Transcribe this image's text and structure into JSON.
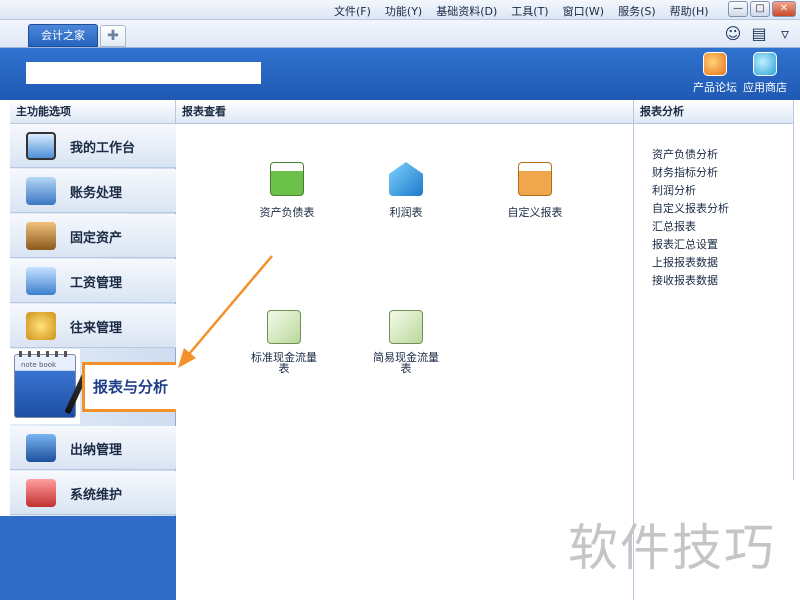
{
  "menu": [
    "文件(F)",
    "功能(Y)",
    "基础资料(D)",
    "工具(T)",
    "窗口(W)",
    "服务(S)",
    "帮助(H)"
  ],
  "window_buttons": [
    "—",
    "□",
    "✕"
  ],
  "tab": {
    "active_label": "会计之家",
    "add_label": "✚"
  },
  "banner": {
    "apps": [
      {
        "label": "产品论坛"
      },
      {
        "label": "应用商店"
      }
    ]
  },
  "panels": {
    "left_title": "主功能选项",
    "middle_title": "报表查看",
    "right_title": "报表分析"
  },
  "nav": [
    {
      "label": "我的工作台",
      "icon": "desktop-icon"
    },
    {
      "label": "账务处理",
      "icon": "ledger-icon"
    },
    {
      "label": "固定资产",
      "icon": "house-icon"
    },
    {
      "label": "工资管理",
      "icon": "wage-icon"
    },
    {
      "label": "往来管理",
      "icon": "coins-icon"
    },
    {
      "label": "报表与分析",
      "icon": "notebook-icon",
      "active": true
    },
    {
      "label": "出纳管理",
      "icon": "cashier-icon"
    },
    {
      "label": "系统维护",
      "icon": "tools-icon"
    }
  ],
  "notebook_text": "note book",
  "reports": [
    {
      "label": "资产负债表",
      "icon": "balance-sheet-icon"
    },
    {
      "label": "利润表",
      "icon": "profit-icon"
    },
    {
      "label": "自定义报表",
      "icon": "custom-report-icon"
    },
    {
      "label": "标准现金流量表",
      "icon": "cashflow-icon"
    },
    {
      "label": "简易现金流量表",
      "icon": "cashflow-icon"
    }
  ],
  "analysis_links": [
    "资产负债分析",
    "财务指标分析",
    "利润分析",
    "自定义报表分析",
    "汇总报表",
    "报表汇总设置",
    "上报报表数据",
    "接收报表数据"
  ],
  "watermark": "软件技巧",
  "colors": {
    "accent_blue": "#2f73cf",
    "highlight_orange": "#f3902a"
  }
}
